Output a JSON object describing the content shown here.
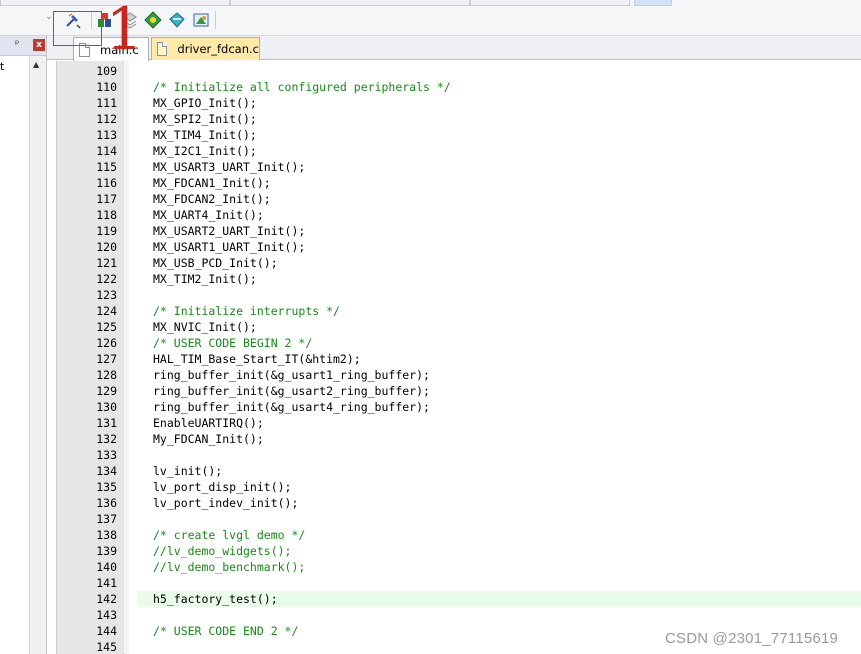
{
  "toolbar": {
    "buttons": [
      {
        "name": "build-settings-icon"
      },
      {
        "name": "pack-installer-icon"
      },
      {
        "name": "stack-icon"
      },
      {
        "name": "component-manager-icon"
      },
      {
        "name": "diamond-download-icon"
      },
      {
        "name": "layers-icon"
      }
    ]
  },
  "annotation": {
    "number": "1",
    "color": "#c8251e"
  },
  "left_panel": {
    "pin_glyph": "ᵖ",
    "close_glyph": "x",
    "tree_text": "t"
  },
  "tabs": [
    {
      "label": "main.c",
      "active": true
    },
    {
      "label": "driver_fdcan.c",
      "active": false
    }
  ],
  "editor": {
    "highlighted_line": "142",
    "lines": [
      {
        "n": "109",
        "text": "",
        "type": "code"
      },
      {
        "n": "110",
        "text": "/* Initialize all configured peripherals */",
        "type": "comment"
      },
      {
        "n": "111",
        "text": "MX_GPIO_Init();",
        "type": "code"
      },
      {
        "n": "112",
        "text": "MX_SPI2_Init();",
        "type": "code"
      },
      {
        "n": "113",
        "text": "MX_TIM4_Init();",
        "type": "code"
      },
      {
        "n": "114",
        "text": "MX_I2C1_Init();",
        "type": "code"
      },
      {
        "n": "115",
        "text": "MX_USART3_UART_Init();",
        "type": "code"
      },
      {
        "n": "116",
        "text": "MX_FDCAN1_Init();",
        "type": "code"
      },
      {
        "n": "117",
        "text": "MX_FDCAN2_Init();",
        "type": "code"
      },
      {
        "n": "118",
        "text": "MX_UART4_Init();",
        "type": "code"
      },
      {
        "n": "119",
        "text": "MX_USART2_UART_Init();",
        "type": "code"
      },
      {
        "n": "120",
        "text": "MX_USART1_UART_Init();",
        "type": "code"
      },
      {
        "n": "121",
        "text": "MX_USB_PCD_Init();",
        "type": "code"
      },
      {
        "n": "122",
        "text": "MX_TIM2_Init();",
        "type": "code"
      },
      {
        "n": "123",
        "text": "",
        "type": "code"
      },
      {
        "n": "124",
        "text": "/* Initialize interrupts */",
        "type": "comment"
      },
      {
        "n": "125",
        "text": "MX_NVIC_Init();",
        "type": "code"
      },
      {
        "n": "126",
        "text": "/* USER CODE BEGIN 2 */",
        "type": "comment"
      },
      {
        "n": "127",
        "text": "HAL_TIM_Base_Start_IT(&htim2);",
        "type": "code"
      },
      {
        "n": "128",
        "text": "ring_buffer_init(&g_usart1_ring_buffer);",
        "type": "code"
      },
      {
        "n": "129",
        "text": "ring_buffer_init(&g_usart2_ring_buffer);",
        "type": "code"
      },
      {
        "n": "130",
        "text": "ring_buffer_init(&g_usart4_ring_buffer);",
        "type": "code"
      },
      {
        "n": "131",
        "text": "EnableUARTIRQ();",
        "type": "code"
      },
      {
        "n": "132",
        "text": "My_FDCAN_Init();",
        "type": "code"
      },
      {
        "n": "133",
        "text": "",
        "type": "code"
      },
      {
        "n": "134",
        "text": "lv_init();",
        "type": "code"
      },
      {
        "n": "135",
        "text": "lv_port_disp_init();",
        "type": "code"
      },
      {
        "n": "136",
        "text": "lv_port_indev_init();",
        "type": "code"
      },
      {
        "n": "137",
        "text": "",
        "type": "code"
      },
      {
        "n": "138",
        "text": "/* create lvgl demo */",
        "type": "comment"
      },
      {
        "n": "139",
        "text": "//lv_demo_widgets();",
        "type": "comment"
      },
      {
        "n": "140",
        "text": "//lv_demo_benchmark();",
        "type": "comment"
      },
      {
        "n": "141",
        "text": "",
        "type": "code"
      },
      {
        "n": "142",
        "text": "h5_factory_test();",
        "type": "code"
      },
      {
        "n": "143",
        "text": "",
        "type": "code"
      },
      {
        "n": "144",
        "text": "/* USER CODE END 2 */",
        "type": "comment"
      },
      {
        "n": "145",
        "text": "",
        "type": "code"
      }
    ]
  },
  "watermark": "CSDN @2301_77115619"
}
